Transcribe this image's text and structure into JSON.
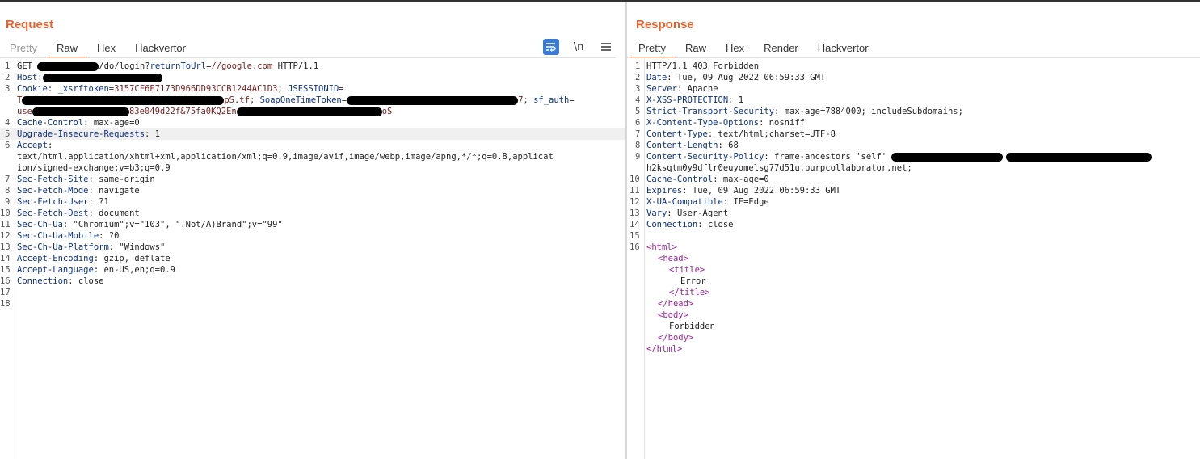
{
  "request": {
    "title": "Request",
    "tabs": [
      "Pretty",
      "Raw",
      "Hex",
      "Hackvertor"
    ],
    "active_tab": "Raw",
    "tools": {
      "wrap_icon": "word-wrap-icon",
      "newline_label": "\\n",
      "menu_icon": "menu-icon"
    },
    "lines": {
      "l1_method": "GET ",
      "l1_path": "/do/login?",
      "l1_param": "returnToUrl",
      "l1_eq": "=",
      "l1_value": "//google.com",
      "l1_proto": " HTTP/1.1",
      "l2_key": "Host:",
      "l3_key": "Cookie: ",
      "l3_name1": "_xsrftoken",
      "l3_eq1": "=",
      "l3_val1": "3157CF6E7173D966DD93CCB1244AC1D3",
      "l3_sep1": "; ",
      "l3_name2": "JSESSIONID",
      "l3_eq2": "=",
      "l3c1_start": "T",
      "l3c1_mid": "pS.tf",
      "l3c1_sep": "; ",
      "l3c1_name": "SoapOneTimeToken",
      "l3c1_eq": "=",
      "l3c1_tail": "7",
      "l3c1_sep2": "; ",
      "l3c1_name2": "sf_auth",
      "l3c1_eq2": "=",
      "l3c2_start": "use",
      "l3c2_mid": "83e049d22f&75fa0KQ2En",
      "l3c2_end": "oS",
      "l4_key": "Cache-Control",
      "l4_val": ": max-age=0",
      "l5_key": "Upgrade-Insecure-Requests",
      "l5_val": ": 1",
      "l6_key": "Accept",
      "l6_val": ":",
      "l6c1": "text/html,application/xhtml+xml,application/xml;q=0.9,image/avif,image/webp,image/apng,*/*;q=0.8,applicat",
      "l6c2": "ion/signed-exchange;v=b3;q=0.9",
      "l7_key": "Sec-Fetch-Site",
      "l7_val": ": same-origin",
      "l8_key": "Sec-Fetch-Mode",
      "l8_val": ": navigate",
      "l9_key": "Sec-Fetch-User",
      "l9_val": ": ?1",
      "l10_key": "Sec-Fetch-Dest",
      "l10_val": ": document",
      "l11_key": "Sec-Ch-Ua",
      "l11_val": ": \"Chromium\";v=\"103\", \".Not/A)Brand\";v=\"99\"",
      "l12_key": "Sec-Ch-Ua-Mobile",
      "l12_val": ": ?0",
      "l13_key": "Sec-Ch-Ua-Platform",
      "l13_val": ": \"Windows\"",
      "l14_key": "Accept-Encoding",
      "l14_val": ": gzip, deflate",
      "l15_key": "Accept-Language",
      "l15_val": ": en-US,en;q=0.9",
      "l16_key": "Connection",
      "l16_val": ": close"
    },
    "line_numbers": [
      "1",
      "2",
      "3",
      "4",
      "5",
      "6",
      "7",
      "8",
      "9",
      "10",
      "11",
      "12",
      "13",
      "14",
      "15",
      "16",
      "17",
      "18"
    ]
  },
  "response": {
    "title": "Response",
    "tabs": [
      "Pretty",
      "Raw",
      "Hex",
      "Render",
      "Hackvertor"
    ],
    "active_tab": "Pretty",
    "lines": {
      "l1": "HTTP/1.1 403 Forbidden",
      "l2_key": "Date",
      "l2_val": ": Tue, 09 Aug 2022 06:59:33 GMT",
      "l3_key": "Server",
      "l3_val": ": Apache",
      "l4_key": "X-XSS-PROTECTION",
      "l4_val": ": 1",
      "l5_key": "Strict-Transport-Security",
      "l5_val": ": max-age=7884000; includeSubdomains;",
      "l6_key": "X-Content-Type-Options",
      "l6_val": ": nosniff",
      "l7_key": "Content-Type",
      "l7_val": ": text/html;charset=UTF-8",
      "l8_key": "Content-Length",
      "l8_val": ": 68",
      "l9_key": "Content-Security-Policy",
      "l9_val": ": frame-ancestors 'self' ",
      "l9c1": "h2ksqtm0y9dflr0euyomelsg77d51u.burpcollaborator.net;",
      "l10_key": "Cache-Control",
      "l10_val": ": max-age=0",
      "l11_key": "Expires",
      "l11_val": ": Tue, 09 Aug 2022 06:59:33 GMT",
      "l12_key": "X-UA-Compatible",
      "l12_val": ": IE=Edge",
      "l13_key": "Vary",
      "l13_val": ": User-Agent",
      "l14_key": "Connection",
      "l14_val": ": close",
      "b_html_open": "<html>",
      "b_head_open": "<head>",
      "b_title_open": "<title>",
      "b_title_text": "Error",
      "b_title_close": "</title>",
      "b_head_close": "</head>",
      "b_body_open": "<body>",
      "b_body_text": "Forbidden",
      "b_body_close": "</body>",
      "b_html_close": "</html>"
    },
    "line_numbers": [
      "1",
      "2",
      "3",
      "4",
      "5",
      "6",
      "7",
      "8",
      "9",
      "10",
      "11",
      "12",
      "13",
      "14",
      "15",
      "16"
    ]
  }
}
